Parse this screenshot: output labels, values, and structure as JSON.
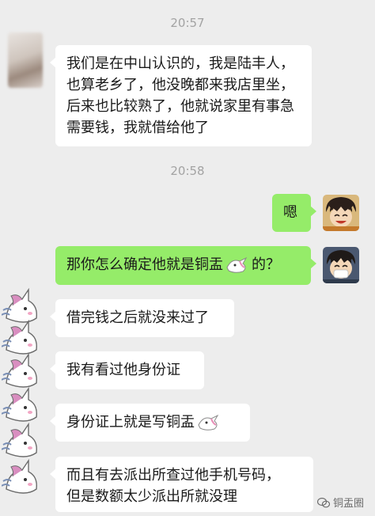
{
  "timestamps": [
    "20:57",
    "20:58"
  ],
  "messages": {
    "m1": "我们是在中山认识的，我是陆丰人，也算老乡了，他没晚都来我店里坐，后来也比较熟了，他就说家里有事急需要钱，我就借给他了",
    "m2": "嗯",
    "m3_before": "那你怎么确定他就是铜盂",
    "m3_after": "的？",
    "m4": "借完钱之后就没来过了",
    "m5": "我有看过他身份证",
    "m6_before": "身份证上就是写铜盂",
    "m7_line1": "而且有去派出所查过他手机号码，",
    "m7_line2": "但是数额太少派出所就没理"
  },
  "watermark": "铜盂圈",
  "colors": {
    "background": "#ededed",
    "sent_bubble": "#95ec69",
    "received_bubble": "#ffffff",
    "timestamp": "#a3a3a3"
  },
  "icons": {
    "self_avatar": "cartoon-boy-avatar",
    "other_avatar": "unicorn-sticker-avatar",
    "watermark_icon": "wechat-icon"
  }
}
